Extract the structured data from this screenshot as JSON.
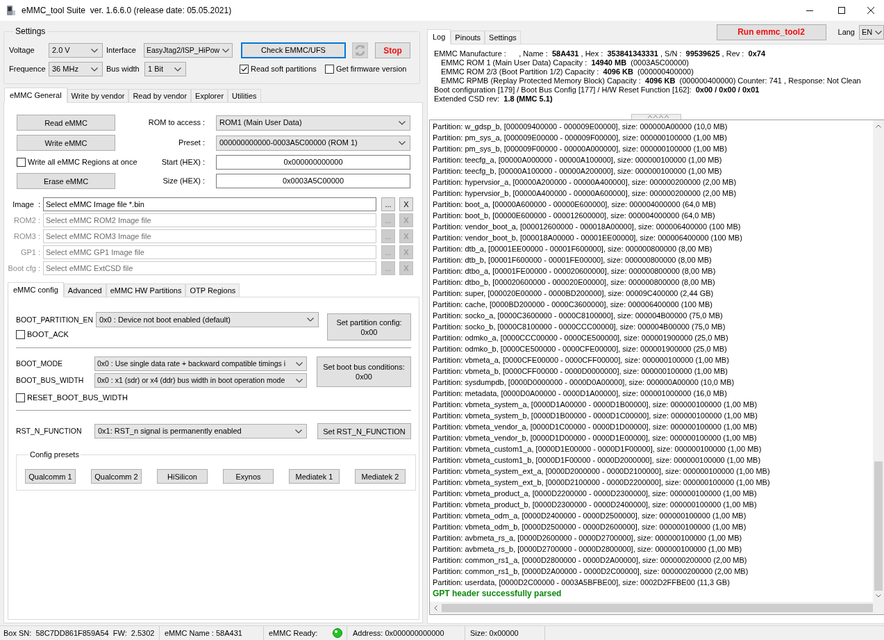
{
  "window": {
    "title": "eMMC_tool Suite  ver. 1.6.6.0 (release date: 05.05.2021)"
  },
  "settings": {
    "title": "Settings",
    "voltage": {
      "label": "Voltage",
      "value": "2.0 V"
    },
    "interface": {
      "label": "Interface",
      "value": "EasyJtag2/ISP_HiPow"
    },
    "frequence": {
      "label": "Frequence",
      "value": "36 MHz"
    },
    "bus_width": {
      "label": "Bus width",
      "value": "1 Bit"
    },
    "check_button": {
      "label": "Check EMMC/UFS",
      "focused": true
    },
    "stop_button": {
      "label": "Stop"
    },
    "options": [
      {
        "label": "Read soft partitions",
        "checked": true
      },
      {
        "label": "Get firmware version",
        "checked": false
      }
    ]
  },
  "main_tabs": [
    {
      "label": "eMMC General",
      "selected": true
    },
    {
      "label": "Write by vendor",
      "selected": false
    },
    {
      "label": "Read by vendor",
      "selected": false
    },
    {
      "label": "Explorer",
      "selected": false
    },
    {
      "label": "Utilities",
      "selected": false
    }
  ],
  "general": {
    "actions": [
      {
        "kind": "button",
        "label": "Read eMMC"
      },
      {
        "kind": "button",
        "label": "Write eMMC"
      },
      {
        "kind": "checkbox",
        "label": "Write all eMMC Regions at once",
        "checked": false
      },
      {
        "kind": "button",
        "label": "Erase eMMC"
      }
    ],
    "fields": [
      {
        "kind": "select",
        "label": "ROM to access :",
        "value": "ROM1 (Main User Data)"
      },
      {
        "kind": "select",
        "label": "Preset :",
        "value": "000000000000-0003A5C00000 (ROM 1)"
      },
      {
        "kind": "input",
        "label": "Start (HEX) :",
        "value": "0x000000000000"
      },
      {
        "kind": "input",
        "label": "Size (HEX) :",
        "value": "0x0003A5C00000"
      }
    ],
    "files": [
      {
        "label": "Image  :",
        "value": "Select eMMC Image file *.bin",
        "browse": "...",
        "clear": "X",
        "disabled": false
      },
      {
        "label": "ROM2 :",
        "value": "Select eMMC ROM2 Image file",
        "browse": "...",
        "clear": "X",
        "disabled": true
      },
      {
        "label": "ROM3 :",
        "value": "Select eMMC ROM3 Image file",
        "browse": "...",
        "clear": "X",
        "disabled": true
      },
      {
        "label": "GP1 :",
        "value": "Select eMMC GP1 Image file",
        "browse": "...",
        "clear": "X",
        "disabled": true
      },
      {
        "label": "Boot cfg :",
        "value": "Select eMMC ExtCSD file",
        "browse": "...",
        "clear": "X",
        "disabled": true
      }
    ]
  },
  "config_tabs": [
    {
      "label": "eMMC config",
      "selected": true
    },
    {
      "label": "Advanced",
      "selected": false
    },
    {
      "label": "eMMC HW Partitions",
      "selected": false
    },
    {
      "label": "OTP Regions",
      "selected": false
    }
  ],
  "config": {
    "partition": {
      "label": "BOOT_PARTITION_EN",
      "value": "0x0 : Device not boot enabled (default)",
      "checkbox": {
        "label": "BOOT_ACK",
        "checked": false
      },
      "button": [
        "Set partition config:",
        "0x00"
      ]
    },
    "bus": {
      "rows": [
        {
          "label": "BOOT_MODE",
          "value": "0x0 : Use single data rate + backward compatible timings i"
        },
        {
          "label": "BOOT_BUS_WIDTH",
          "value": "0x0 : x1 (sdr) or x4 (ddr) bus width in boot operation mode"
        }
      ],
      "checkbox": {
        "label": "RESET_BOOT_BUS_WIDTH",
        "checked": false
      },
      "button": [
        "Set boot bus conditions:",
        "0x00"
      ]
    },
    "reset": {
      "label": "RST_N_FUNCTION",
      "value": "0x1: RST_n signal is permanently enabled",
      "button": [
        "Set RST_N_FUNCTION"
      ]
    },
    "presets": {
      "title": "Config presets",
      "buttons": [
        "Qualcomm 1",
        "Qualcomm 2",
        "HiSilicon",
        "Exynos",
        "Mediatek 1",
        "Mediatek 2"
      ]
    }
  },
  "log_tabs": [
    {
      "label": "Log",
      "selected": true
    },
    {
      "label": "Pinouts",
      "selected": false
    },
    {
      "label": "Settings",
      "selected": false
    }
  ],
  "run_button": "Run emmc_tool2",
  "lang": {
    "label": "Lang",
    "value": "EN"
  },
  "device_info": [
    {
      "text": "EMMC Manufacture :      , Name :  **58A431** , Hex :  **353841343331** , S/N :  **99539625** , Rev :  **0x74**",
      "children": [
        {
          "text": "EMMC ROM 1 (Main User Data) Capacity :  **14940 MB**  (0003A5C00000)"
        },
        {
          "text": "EMMC ROM 2/3 (Boot Partition 1/2) Capacity :  **4096 KB**  (000000400000)"
        },
        {
          "text": "EMMC RPMB (Replay Protected Memory Block) Capacity :  **4096 KB**  (000000400000) Counter: 741 , Response: Not Clean"
        }
      ]
    },
    {
      "text": "Boot configuration [179] / Boot Bus Config [177] / H/W Reset Function [162]:  **0x00 / 0x00 / 0x01**"
    },
    {
      "text": "Extended CSD rev:  **1.8 (MMC 5.1)**"
    }
  ],
  "log": [
    {
      "kind": "info",
      "text": "Partition: w_gdsp_b, [000009400000 - 000009E00000], size: 000000A00000 (10,0 MB)"
    },
    {
      "kind": "info",
      "text": "Partition: pm_sys_a, [000009E00000 - 000009F00000], size: 000000100000 (1,00 MB)"
    },
    {
      "kind": "info",
      "text": "Partition: pm_sys_b, [000009F00000 - 00000A000000], size: 000000100000 (1,00 MB)"
    },
    {
      "kind": "info",
      "text": "Partition: teecfg_a, [00000A000000 - 00000A100000], size: 000000100000 (1,00 MB)"
    },
    {
      "kind": "info",
      "text": "Partition: teecfg_b, [00000A100000 - 00000A200000], size: 000000100000 (1,00 MB)"
    },
    {
      "kind": "info",
      "text": "Partition: hypervsior_a, [00000A200000 - 00000A400000], size: 000000200000 (2,00 MB)"
    },
    {
      "kind": "info",
      "text": "Partition: hypervsior_b, [00000A400000 - 00000A600000], size: 000000200000 (2,00 MB)"
    },
    {
      "kind": "info",
      "text": "Partition: boot_a, [00000A600000 - 00000E600000], size: 000004000000 (64,0 MB)"
    },
    {
      "kind": "info",
      "text": "Partition: boot_b, [00000E600000 - 000012600000], size: 000004000000 (64,0 MB)"
    },
    {
      "kind": "info",
      "text": "Partition: vendor_boot_a, [000012600000 - 000018A00000], size: 000006400000 (100 MB)"
    },
    {
      "kind": "info",
      "text": "Partition: vendor_boot_b, [000018A00000 - 00001EE00000], size: 000006400000 (100 MB)"
    },
    {
      "kind": "info",
      "text": "Partition: dtb_a, [00001EE00000 - 00001F600000], size: 000000800000 (8,00 MB)"
    },
    {
      "kind": "info",
      "text": "Partition: dtb_b, [00001F600000 - 00001FE00000], size: 000000800000 (8,00 MB)"
    },
    {
      "kind": "info",
      "text": "Partition: dtbo_a, [00001FE00000 - 000020600000], size: 000000800000 (8,00 MB)"
    },
    {
      "kind": "info",
      "text": "Partition: dtbo_b, [000020600000 - 000020E00000], size: 000000800000 (8,00 MB)"
    },
    {
      "kind": "info",
      "text": "Partition: super, [000020E00000 - 0000BD200000], size: 00009C400000 (2,44 GB)"
    },
    {
      "kind": "info",
      "text": "Partition: cache, [0000BD200000 - 0000C3600000], size: 000006400000 (100 MB)"
    },
    {
      "kind": "info",
      "text": "Partition: socko_a, [0000C3600000 - 0000C8100000], size: 000004B00000 (75,0 MB)"
    },
    {
      "kind": "info",
      "text": "Partition: socko_b, [0000C8100000 - 0000CCC00000], size: 000004B00000 (75,0 MB)"
    },
    {
      "kind": "info",
      "text": "Partition: odmko_a, [0000CCC00000 - 0000CE500000], size: 000001900000 (25,0 MB)"
    },
    {
      "kind": "info",
      "text": "Partition: odmko_b, [0000CE500000 - 0000CFE00000], size: 000001900000 (25,0 MB)"
    },
    {
      "kind": "info",
      "text": "Partition: vbmeta_a, [0000CFE00000 - 0000CFF00000], size: 000000100000 (1,00 MB)"
    },
    {
      "kind": "info",
      "text": "Partition: vbmeta_b, [0000CFF00000 - 0000D0000000], size: 000000100000 (1,00 MB)"
    },
    {
      "kind": "info",
      "text": "Partition: sysdumpdb, [0000D0000000 - 0000D0A00000], size: 000000A00000 (10,0 MB)"
    },
    {
      "kind": "info",
      "text": "Partition: metadata, [0000D0A00000 - 0000D1A00000], size: 000001000000 (16,0 MB)"
    },
    {
      "kind": "info",
      "text": "Partition: vbmeta_system_a, [0000D1A00000 - 0000D1B00000], size: 000000100000 (1,00 MB)"
    },
    {
      "kind": "info",
      "text": "Partition: vbmeta_system_b, [0000D1B00000 - 0000D1C00000], size: 000000100000 (1,00 MB)"
    },
    {
      "kind": "info",
      "text": "Partition: vbmeta_vendor_a, [0000D1C00000 - 0000D1D00000], size: 000000100000 (1,00 MB)"
    },
    {
      "kind": "info",
      "text": "Partition: vbmeta_vendor_b, [0000D1D00000 - 0000D1E00000], size: 000000100000 (1,00 MB)"
    },
    {
      "kind": "info",
      "text": "Partition: vbmeta_custom1_a, [0000D1E00000 - 0000D1F00000], size: 000000100000 (1,00 MB)"
    },
    {
      "kind": "info",
      "text": "Partition: vbmeta_custom1_b, [0000D1F00000 - 0000D2000000], size: 000000100000 (1,00 MB)"
    },
    {
      "kind": "info",
      "text": "Partition: vbmeta_system_ext_a, [0000D2000000 - 0000D2100000], size: 000000100000 (1,00 MB)"
    },
    {
      "kind": "info",
      "text": "Partition: vbmeta_system_ext_b, [0000D2100000 - 0000D2200000], size: 000000100000 (1,00 MB)"
    },
    {
      "kind": "info",
      "text": "Partition: vbmeta_product_a, [0000D2200000 - 0000D2300000], size: 000000100000 (1,00 MB)"
    },
    {
      "kind": "info",
      "text": "Partition: vbmeta_product_b, [0000D2300000 - 0000D2400000], size: 000000100000 (1,00 MB)"
    },
    {
      "kind": "info",
      "text": "Partition: vbmeta_odm_a, [0000D2400000 - 0000D2500000], size: 000000100000 (1,00 MB)"
    },
    {
      "kind": "info",
      "text": "Partition: vbmeta_odm_b, [0000D2500000 - 0000D2600000], size: 000000100000 (1,00 MB)"
    },
    {
      "kind": "info",
      "text": "Partition: avbmeta_rs_a, [0000D2600000 - 0000D2700000], size: 000000100000 (1,00 MB)"
    },
    {
      "kind": "info",
      "text": "Partition: avbmeta_rs_b, [0000D2700000 - 0000D2800000], size: 000000100000 (1,00 MB)"
    },
    {
      "kind": "info",
      "text": "Partition: common_rs1_a, [0000D2800000 - 0000D2A00000], size: 000000200000 (2,00 MB)"
    },
    {
      "kind": "info",
      "text": "Partition: common_rs1_b, [0000D2A00000 - 0000D2C00000], size: 000000200000 (2,00 MB)"
    },
    {
      "kind": "info",
      "text": "Partition: userdata, [0000D2C00000 - 0003A5BFBE00], size: 0002D2FFBE00 (11,3 GB)"
    },
    {
      "kind": "success",
      "text": "GPT header successfully parsed"
    }
  ],
  "status_bar": {
    "box": "Box SN:  58C7DD861F859A54  FW:  2.5302",
    "name": "eMMC Name : 58A431",
    "ready": {
      "label": "eMMC Ready:",
      "on": true
    },
    "address": "Address: 0x000000000000",
    "size": "Size: 0x00000"
  }
}
